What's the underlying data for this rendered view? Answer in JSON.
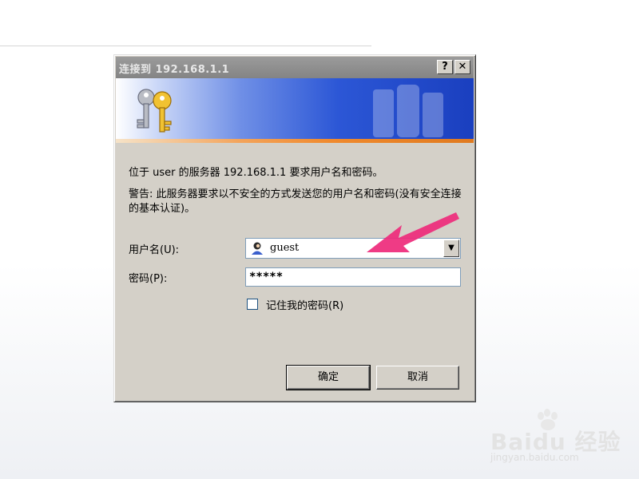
{
  "dialog": {
    "title": "连接到 192.168.1.1",
    "help_button": "?",
    "close_button": "✕",
    "message": "位于 user 的服务器 192.168.1.1 要求用户名和密码。",
    "warning": "警告: 此服务器要求以不安全的方式发送您的用户名和密码(没有安全连接的基本认证)。",
    "username_label": "用户名(U):",
    "username_value": "guest",
    "password_label": "密码(P):",
    "password_value": "*****",
    "remember_label": "记住我的密码(R)",
    "remember_checked": false,
    "ok_label": "确定",
    "cancel_label": "取消"
  },
  "watermark": {
    "brand": "Baidu 经验",
    "url": "jingyan.baidu.com"
  },
  "icons": {
    "banner": "keys-icon",
    "username": "user-icon",
    "dropdown": "chevron-down-icon",
    "annotation": "pink-arrow"
  },
  "colors": {
    "title_bar": "#8c8c8c",
    "dialog_bg": "#d4d0c8",
    "banner_blue": "#2c57d6",
    "banner_orange": "#f08a2e",
    "arrow": "#ee2a7b"
  }
}
